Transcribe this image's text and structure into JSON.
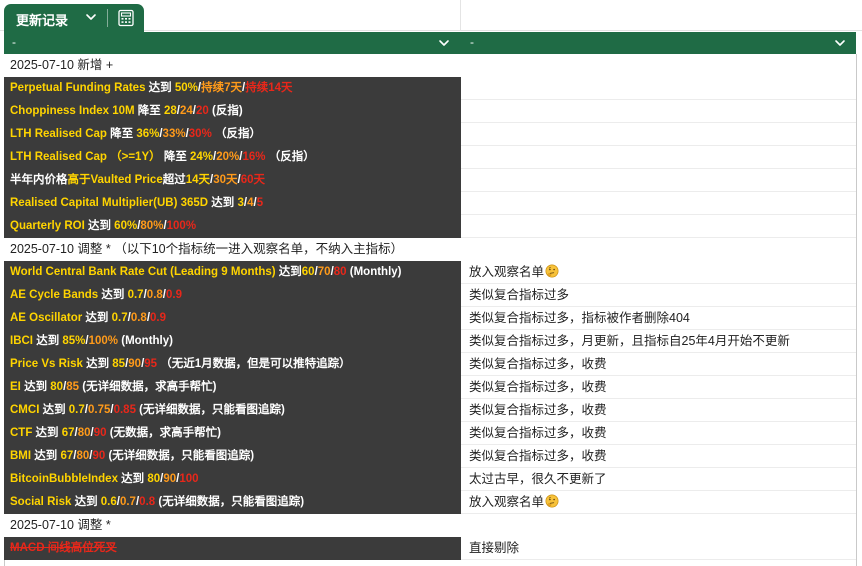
{
  "sheet_tab": {
    "title": "更新记录",
    "chevron_icon": "chevron-down-icon",
    "calc_icon": "calculator-icon"
  },
  "filter_header": {
    "col_a_label": "-",
    "col_b_label": "-",
    "filter_icon": "chevron-down-icon"
  },
  "colors": {
    "header_green": "#1f6b45",
    "dark_row": "#3b3b3b",
    "yellow": "#ffd400",
    "orange": "#ff9a1a",
    "red": "#e8271a"
  },
  "rows": [
    {
      "kind": "section",
      "a": [
        {
          "t": "2025-07-10 新增 +",
          "c": ""
        }
      ],
      "b": ""
    },
    {
      "kind": "dark",
      "a": [
        {
          "t": "Perpetual Funding Rates",
          "c": "yellow"
        },
        {
          "t": " 达到 ",
          "c": "white"
        },
        {
          "t": "50%",
          "c": "yellow"
        },
        {
          "t": "/",
          "c": "white"
        },
        {
          "t": "持续7天",
          "c": "orange"
        },
        {
          "t": "/",
          "c": "white"
        },
        {
          "t": "持续14天",
          "c": "red"
        }
      ],
      "b": ""
    },
    {
      "kind": "dark",
      "a": [
        {
          "t": "Choppiness Index 10M",
          "c": "yellow"
        },
        {
          "t": " 降至 ",
          "c": "white"
        },
        {
          "t": "28",
          "c": "yellow"
        },
        {
          "t": "/",
          "c": "white"
        },
        {
          "t": "24",
          "c": "orange"
        },
        {
          "t": "/",
          "c": "white"
        },
        {
          "t": "20",
          "c": "red"
        },
        {
          "t": " (反指)",
          "c": "white"
        }
      ],
      "b": ""
    },
    {
      "kind": "dark",
      "a": [
        {
          "t": "LTH Realised Cap",
          "c": "yellow"
        },
        {
          "t": " 降至 ",
          "c": "white"
        },
        {
          "t": "36%",
          "c": "yellow"
        },
        {
          "t": "/",
          "c": "white"
        },
        {
          "t": "33%",
          "c": "orange"
        },
        {
          "t": "/",
          "c": "white"
        },
        {
          "t": "30%",
          "c": "red"
        },
        {
          "t": " （反指）",
          "c": "white"
        }
      ],
      "b": ""
    },
    {
      "kind": "dark",
      "a": [
        {
          "t": "LTH Realised Cap （>=1Y）",
          "c": "yellow"
        },
        {
          "t": " 降至 ",
          "c": "white"
        },
        {
          "t": "24%",
          "c": "yellow"
        },
        {
          "t": "/",
          "c": "white"
        },
        {
          "t": "20%",
          "c": "orange"
        },
        {
          "t": "/",
          "c": "white"
        },
        {
          "t": "16%",
          "c": "red"
        },
        {
          "t": " （反指）",
          "c": "white"
        }
      ],
      "b": ""
    },
    {
      "kind": "dark",
      "a": [
        {
          "t": "半年内价格",
          "c": "white"
        },
        {
          "t": "高于Vaulted Price",
          "c": "yellow"
        },
        {
          "t": "超过",
          "c": "white"
        },
        {
          "t": "14天",
          "c": "yellow"
        },
        {
          "t": "/",
          "c": "white"
        },
        {
          "t": "30天",
          "c": "orange"
        },
        {
          "t": "/",
          "c": "white"
        },
        {
          "t": "60天",
          "c": "red"
        }
      ],
      "b": ""
    },
    {
      "kind": "dark",
      "a": [
        {
          "t": "Realised Capital Multiplier(UB)  365D",
          "c": "yellow"
        },
        {
          "t": " 达到 ",
          "c": "white"
        },
        {
          "t": "3",
          "c": "yellow"
        },
        {
          "t": "/",
          "c": "white"
        },
        {
          "t": "4",
          "c": "orange"
        },
        {
          "t": "/",
          "c": "white"
        },
        {
          "t": "5",
          "c": "red"
        }
      ],
      "b": ""
    },
    {
      "kind": "dark",
      "a": [
        {
          "t": "Quarterly ROI",
          "c": "yellow"
        },
        {
          "t": " 达到 ",
          "c": "white"
        },
        {
          "t": "60%",
          "c": "yellow"
        },
        {
          "t": "/",
          "c": "white"
        },
        {
          "t": "80%",
          "c": "orange"
        },
        {
          "t": "/",
          "c": "white"
        },
        {
          "t": "100%",
          "c": "red"
        }
      ],
      "b": ""
    },
    {
      "kind": "section",
      "a": [
        {
          "t": "2025-07-10 调整 * （以下10个指标统一进入观察名单，不纳入主指标）",
          "c": ""
        }
      ],
      "b": ""
    },
    {
      "kind": "dark",
      "a": [
        {
          "t": "World Central Bank Rate Cut (Leading 9 Months)",
          "c": "yellow"
        },
        {
          "t": " 达到",
          "c": "white"
        },
        {
          "t": "60",
          "c": "yellow"
        },
        {
          "t": "/",
          "c": "white"
        },
        {
          "t": "70",
          "c": "orange"
        },
        {
          "t": "/",
          "c": "white"
        },
        {
          "t": "80",
          "c": "red"
        },
        {
          "t": " (Monthly)",
          "c": "white"
        }
      ],
      "b": "放入观察名单",
      "b_emoji": true
    },
    {
      "kind": "dark",
      "a": [
        {
          "t": "AE Cycle Bands",
          "c": "yellow"
        },
        {
          "t": " 达到 ",
          "c": "white"
        },
        {
          "t": "0.7",
          "c": "yellow"
        },
        {
          "t": "/",
          "c": "white"
        },
        {
          "t": "0.8",
          "c": "orange"
        },
        {
          "t": "/",
          "c": "white"
        },
        {
          "t": "0.9",
          "c": "red"
        }
      ],
      "b": "类似复合指标过多"
    },
    {
      "kind": "dark",
      "a": [
        {
          "t": "AE Oscillator",
          "c": "yellow"
        },
        {
          "t": " 达到 ",
          "c": "white"
        },
        {
          "t": "0.7",
          "c": "yellow"
        },
        {
          "t": "/",
          "c": "white"
        },
        {
          "t": "0.8",
          "c": "orange"
        },
        {
          "t": "/",
          "c": "white"
        },
        {
          "t": "0.9",
          "c": "red"
        }
      ],
      "b": "类似复合指标过多，指标被作者删除404"
    },
    {
      "kind": "dark",
      "a": [
        {
          "t": "IBCI",
          "c": "yellow"
        },
        {
          "t": " 达到 ",
          "c": "white"
        },
        {
          "t": "85%",
          "c": "yellow"
        },
        {
          "t": "/",
          "c": "white"
        },
        {
          "t": "100%",
          "c": "orange"
        },
        {
          "t": " (Monthly)",
          "c": "white"
        }
      ],
      "b": "类似复合指标过多，月更新，且指标自25年4月开始不更新"
    },
    {
      "kind": "dark",
      "a": [
        {
          "t": "Price Vs Risk",
          "c": "yellow"
        },
        {
          "t": " 达到 ",
          "c": "white"
        },
        {
          "t": "85",
          "c": "yellow"
        },
        {
          "t": "/",
          "c": "white"
        },
        {
          "t": "90",
          "c": "orange"
        },
        {
          "t": "/",
          "c": "white"
        },
        {
          "t": "95",
          "c": "red"
        },
        {
          "t": " （无近1月数据，但是可以推特追踪）",
          "c": "white"
        }
      ],
      "b": "类似复合指标过多，收费"
    },
    {
      "kind": "dark",
      "a": [
        {
          "t": "EI",
          "c": "yellow"
        },
        {
          "t": " 达到 ",
          "c": "white"
        },
        {
          "t": "80",
          "c": "yellow"
        },
        {
          "t": "/",
          "c": "white"
        },
        {
          "t": "85",
          "c": "orange"
        },
        {
          "t": " (无详细数据，求高手帮忙)",
          "c": "white"
        }
      ],
      "b": "类似复合指标过多，收费"
    },
    {
      "kind": "dark",
      "a": [
        {
          "t": "CMCI",
          "c": "yellow"
        },
        {
          "t": " 达到 ",
          "c": "white"
        },
        {
          "t": "0.7",
          "c": "yellow"
        },
        {
          "t": "/",
          "c": "white"
        },
        {
          "t": "0.75",
          "c": "orange"
        },
        {
          "t": "/",
          "c": "white"
        },
        {
          "t": "0.85",
          "c": "red"
        },
        {
          "t": " (无详细数据，只能看图追踪)",
          "c": "white"
        }
      ],
      "b": "类似复合指标过多，收费"
    },
    {
      "kind": "dark",
      "a": [
        {
          "t": "CTF",
          "c": "yellow"
        },
        {
          "t": " 达到 ",
          "c": "white"
        },
        {
          "t": "67",
          "c": "yellow"
        },
        {
          "t": "/",
          "c": "white"
        },
        {
          "t": "80",
          "c": "orange"
        },
        {
          "t": "/",
          "c": "white"
        },
        {
          "t": "90",
          "c": "red"
        },
        {
          "t": " (无数据，求高手帮忙)",
          "c": "white"
        }
      ],
      "b": "类似复合指标过多，收费"
    },
    {
      "kind": "dark",
      "a": [
        {
          "t": "BMI",
          "c": "yellow"
        },
        {
          "t": " 达到 ",
          "c": "white"
        },
        {
          "t": "67",
          "c": "yellow"
        },
        {
          "t": "/",
          "c": "white"
        },
        {
          "t": "80",
          "c": "orange"
        },
        {
          "t": "/",
          "c": "white"
        },
        {
          "t": "90",
          "c": "red"
        },
        {
          "t": " (无详细数据，只能看图追踪)",
          "c": "white"
        }
      ],
      "b": "类似复合指标过多，收费"
    },
    {
      "kind": "dark",
      "a": [
        {
          "t": "BitcoinBubbleIndex",
          "c": "yellow"
        },
        {
          "t": " 达到 ",
          "c": "white"
        },
        {
          "t": "80",
          "c": "yellow"
        },
        {
          "t": "/",
          "c": "white"
        },
        {
          "t": "90",
          "c": "orange"
        },
        {
          "t": "/",
          "c": "white"
        },
        {
          "t": "100",
          "c": "red"
        }
      ],
      "b": "太过古早，很久不更新了"
    },
    {
      "kind": "dark",
      "a": [
        {
          "t": "Social Risk",
          "c": "yellow"
        },
        {
          "t": " 达到 ",
          "c": "white"
        },
        {
          "t": "0.6",
          "c": "yellow"
        },
        {
          "t": "/",
          "c": "white"
        },
        {
          "t": "0.7",
          "c": "orange"
        },
        {
          "t": "/",
          "c": "white"
        },
        {
          "t": "0.8",
          "c": "red"
        },
        {
          "t": " (无详细数据，只能看图追踪)",
          "c": "white"
        }
      ],
      "b": "放入观察名单",
      "b_emoji": true
    },
    {
      "kind": "section",
      "a": [
        {
          "t": "2025-07-10 调整 *",
          "c": ""
        }
      ],
      "b": ""
    },
    {
      "kind": "dark",
      "a": [
        {
          "t": "MACD 间线高位死叉",
          "c": "red",
          "strike": true
        }
      ],
      "b": "直接剔除"
    }
  ],
  "emoji_icon": "thinking-face-icon"
}
